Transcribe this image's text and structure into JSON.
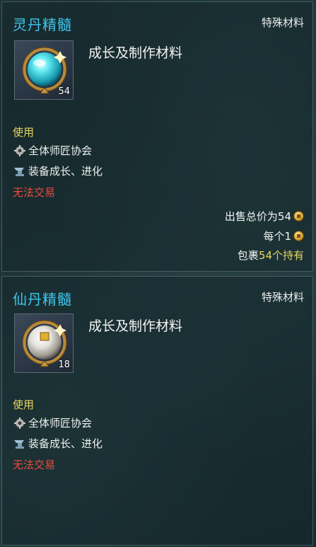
{
  "items": [
    {
      "name": "灵丹精髓",
      "category": "特殊材料",
      "description": "成长及制作材料",
      "quantity": "54",
      "usage_label": "使用",
      "properties": [
        "全体师匠协会",
        "装备成长、进化"
      ],
      "trade_status": "无法交易",
      "sale_total_label": "出售总价为",
      "sale_total_value": "54",
      "each_label": "每个",
      "each_value": "1",
      "inventory_prefix": "包裹",
      "inventory_highlight": "54个持有",
      "orb_color": "#3fd8e6"
    },
    {
      "name": "仙丹精髓",
      "category": "特殊材料",
      "description": "成长及制作材料",
      "quantity": "18",
      "usage_label": "使用",
      "properties": [
        "全体师匠协会",
        "装备成长、进化"
      ],
      "trade_status": "无法交易",
      "orb_color": "#e6e6e0"
    }
  ],
  "colors": {
    "title": "#3fc6ec",
    "usage": "#e8d660",
    "no_trade": "#ee4a3e",
    "highlight": "#e8d660"
  }
}
